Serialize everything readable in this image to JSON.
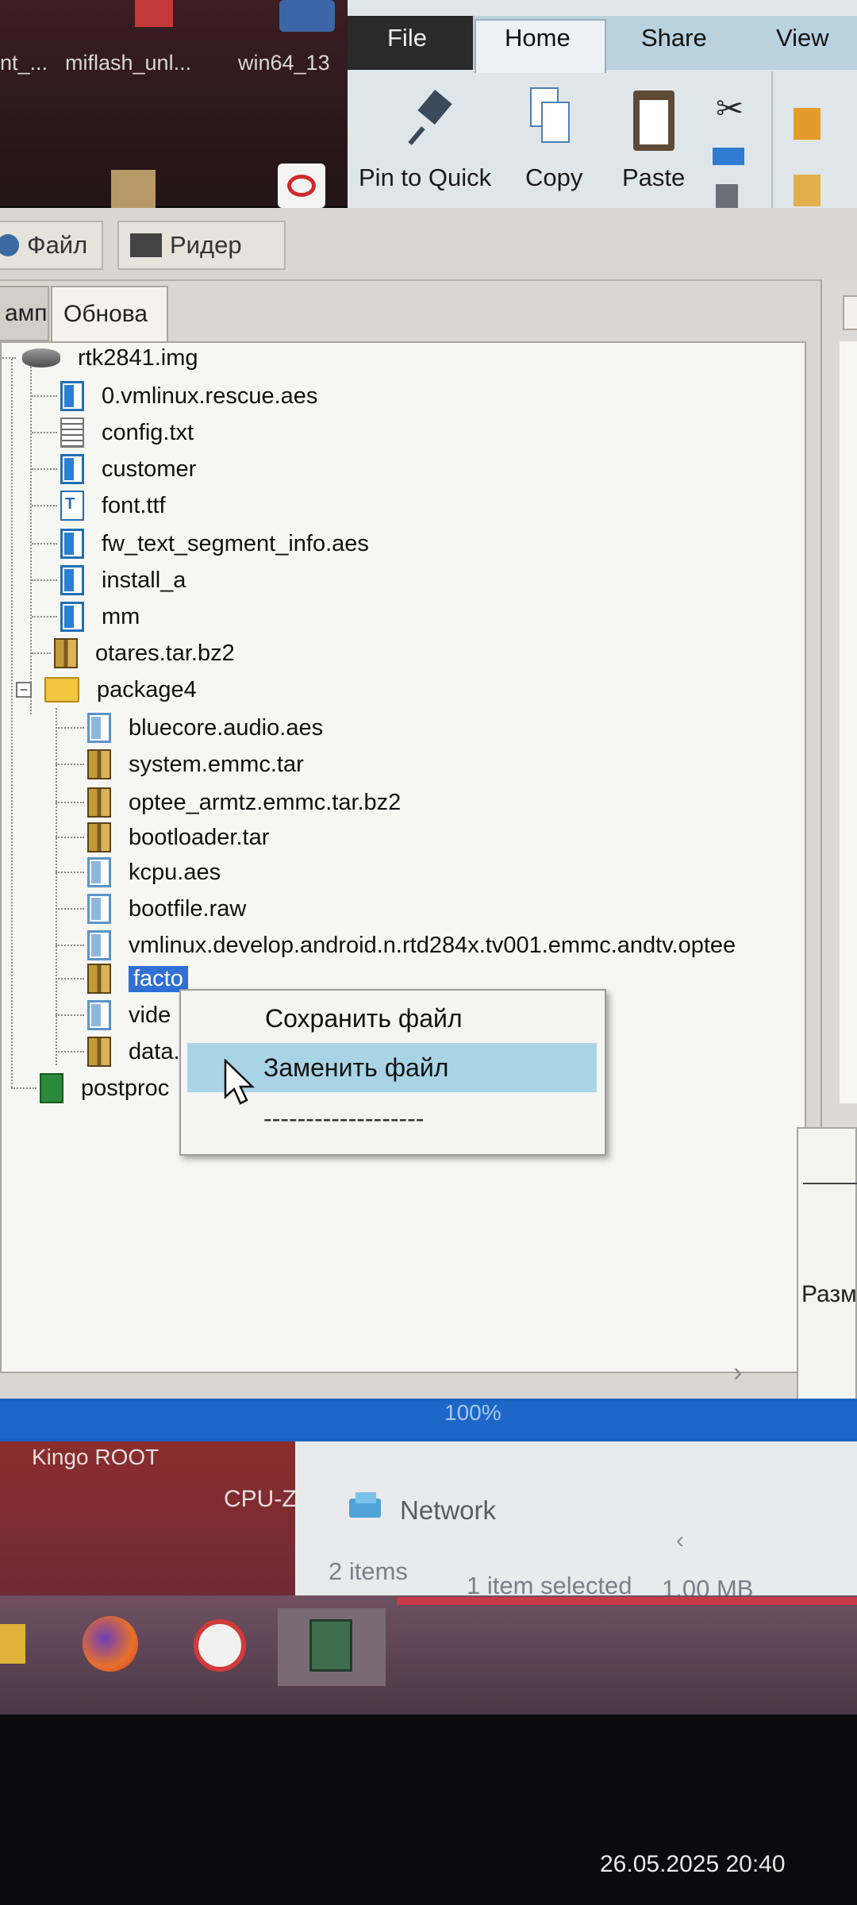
{
  "desktop": {
    "top_labels": [
      "nt_...",
      "miflash_unl...",
      "win64_13"
    ],
    "bottom_labels": [
      "Kingo ROOT",
      "CPU-Z"
    ]
  },
  "ribbon": {
    "tabs": [
      "File",
      "Home",
      "Share",
      "View"
    ],
    "active_tab": "Home",
    "buttons": [
      "Pin to Quick",
      "Copy",
      "Paste"
    ]
  },
  "app": {
    "toolbar": [
      "Файл",
      "Ридер"
    ],
    "tabs": [
      "амп",
      "Обнова"
    ],
    "tree": [
      {
        "label": "rtk2841.img",
        "icon": "disk-icon"
      },
      {
        "label": "0.vmlinux.rescue.aes",
        "icon": "file-icon"
      },
      {
        "label": "config.txt",
        "icon": "text-file-icon"
      },
      {
        "label": "customer",
        "icon": "file-icon"
      },
      {
        "label": "font.ttf",
        "icon": "font-file-icon"
      },
      {
        "label": "fw_text_segment_info.aes",
        "icon": "file-icon"
      },
      {
        "label": "install_a",
        "icon": "file-icon"
      },
      {
        "label": "mm",
        "icon": "file-icon"
      },
      {
        "label": "otares.tar.bz2",
        "icon": "archive-icon"
      },
      {
        "label": "package4",
        "icon": "folder-icon"
      },
      {
        "label": "bluecore.audio.aes",
        "icon": "file-icon"
      },
      {
        "label": "system.emmc.tar",
        "icon": "archive-icon"
      },
      {
        "label": "optee_armtz.emmc.tar.bz2",
        "icon": "archive-icon"
      },
      {
        "label": "bootloader.tar",
        "icon": "archive-icon"
      },
      {
        "label": "kcpu.aes",
        "icon": "file-icon"
      },
      {
        "label": "bootfile.raw",
        "icon": "file-icon"
      },
      {
        "label": "vmlinux.develop.android.n.rtd284x.tv001.emmc.andtv.optee",
        "icon": "file-icon"
      },
      {
        "label": "facto",
        "icon": "archive-icon"
      },
      {
        "label": "vide",
        "icon": "file-icon"
      },
      {
        "label": "data.",
        "icon": "archive-icon"
      },
      {
        "label": "postproc",
        "icon": "exe-icon"
      }
    ],
    "context_menu": {
      "items": [
        "Сохранить файл",
        "Заменить файл",
        "-------------------"
      ],
      "highlighted": "Заменить файл"
    },
    "right_panel_label": "Разм",
    "progress": {
      "label": "100%",
      "value": 1.0
    }
  },
  "explorer_status": {
    "nav_item": "Network",
    "items_count": "2 items",
    "selection": "1 item selected",
    "size": "1,00 MB"
  },
  "timestamp": "26.05.2025  20:40"
}
